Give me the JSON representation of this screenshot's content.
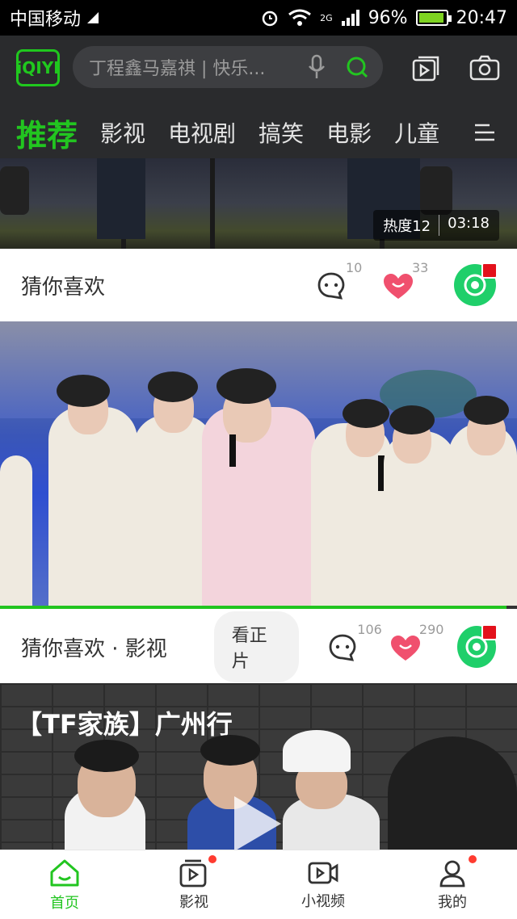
{
  "status_bar": {
    "carrier": "中国移动",
    "network": "2G",
    "battery": "96%",
    "time": "20:47",
    "battery_level": 0.96
  },
  "header": {
    "logo_text": "iQIYI",
    "search_placeholder": "丁程鑫马嘉祺 | 快乐...",
    "accent_color": "#22c520"
  },
  "tabs": [
    {
      "label": "推荐",
      "active": true
    },
    {
      "label": "影视"
    },
    {
      "label": "电视剧"
    },
    {
      "label": "搞笑"
    },
    {
      "label": "电影"
    },
    {
      "label": "儿童"
    }
  ],
  "feed": {
    "item1": {
      "heat": "热度12",
      "duration": "03:18",
      "title": "猜你喜欢",
      "comments": "10",
      "likes": "33"
    },
    "item2": {
      "title": "猜你喜欢 · 影视",
      "watch_button": "看正片",
      "comments": "106",
      "likes": "290",
      "progress": 0.98
    },
    "item3": {
      "title": "【TF家族】广州行"
    }
  },
  "bottom_nav": [
    {
      "label": "首页",
      "icon": "home-icon",
      "active": true
    },
    {
      "label": "影视",
      "icon": "video-icon",
      "dot": true
    },
    {
      "label": "小视频",
      "icon": "camera-icon"
    },
    {
      "label": "我的",
      "icon": "profile-icon",
      "dot": true
    }
  ]
}
